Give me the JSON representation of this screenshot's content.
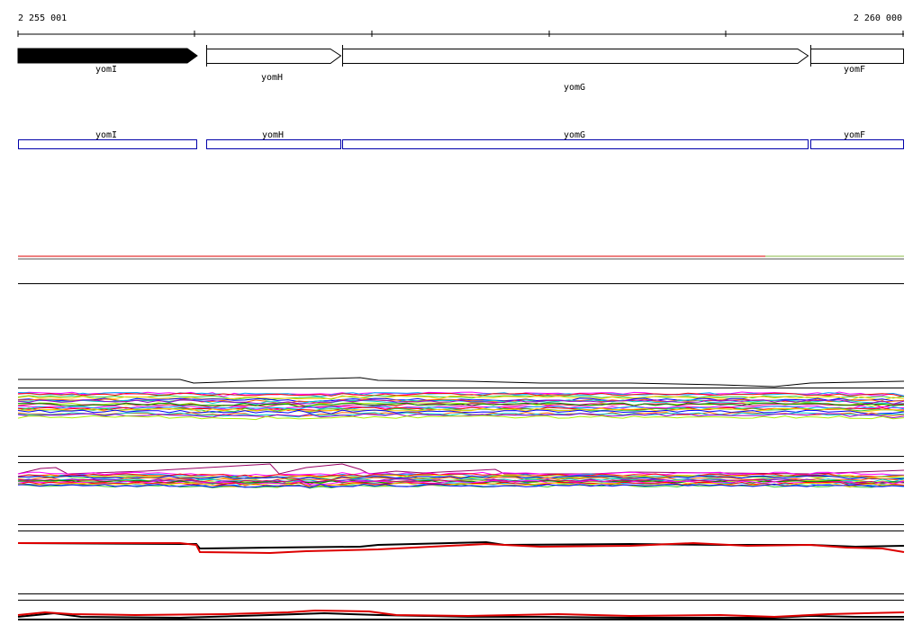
{
  "ruler": {
    "start_label": "2 255 001",
    "end_label": "2 260 000"
  },
  "genes": [
    {
      "name": "yomI",
      "label": "yomI",
      "filled": true
    },
    {
      "name": "yomH",
      "label": "yomH",
      "filled": false
    },
    {
      "name": "yomG",
      "label": "yomG",
      "filled": false
    },
    {
      "name": "yomF",
      "label": "yomF",
      "filled": false
    }
  ],
  "annotations": [
    {
      "label": "yomI"
    },
    {
      "label": "yomH"
    },
    {
      "label": "yomG"
    },
    {
      "label": "yomF"
    }
  ],
  "colors": {
    "axis": "#000000",
    "gene_fill": "#000000",
    "annotation_box": "#0000aa",
    "red_track": "#dd0000",
    "green_tail": "#88bb44",
    "profile_palette": [
      "#ff00ff",
      "#00aaff",
      "#ff0000",
      "#33cc33",
      "#ffcc00",
      "#0000ff",
      "#ff6600",
      "#00cccc",
      "#9900cc",
      "#aaee00",
      "#cc0066",
      "#008800"
    ]
  },
  "tracks": [
    {
      "name": "reference-track",
      "type": "flat-line"
    },
    {
      "name": "profile-track-a",
      "type": "multi-profile"
    },
    {
      "name": "profile-track-b",
      "type": "multi-profile"
    },
    {
      "name": "profile-track-c",
      "type": "two-profile"
    },
    {
      "name": "profile-track-d",
      "type": "two-profile"
    }
  ]
}
